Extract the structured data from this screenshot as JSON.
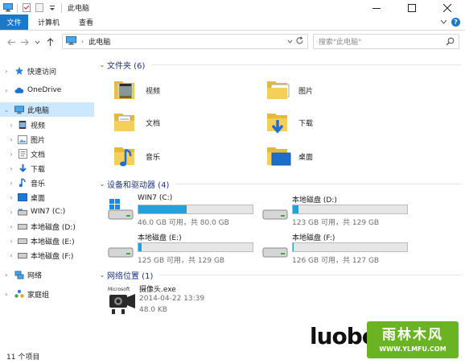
{
  "window": {
    "title": "此电脑",
    "controls": [
      "minimize-icon",
      "maximize-icon",
      "close-icon"
    ]
  },
  "ribbon": {
    "tabs": [
      {
        "label": "文件",
        "active": true
      },
      {
        "label": "计算机",
        "active": false
      },
      {
        "label": "查看",
        "active": false
      }
    ],
    "help_label": "?"
  },
  "address": {
    "path": "此电脑",
    "search_placeholder": "搜索\"此电脑\""
  },
  "nav": {
    "items": [
      {
        "label": "快速访问",
        "icon": "star-icon"
      },
      {
        "label": "OneDrive",
        "icon": "cloud-icon"
      },
      {
        "label": "此电脑",
        "icon": "computer-icon",
        "selected": true
      },
      {
        "label": "视频",
        "icon": "video-folder-icon"
      },
      {
        "label": "图片",
        "icon": "pictures-folder-icon"
      },
      {
        "label": "文档",
        "icon": "documents-folder-icon"
      },
      {
        "label": "下载",
        "icon": "download-arrow-icon"
      },
      {
        "label": "音乐",
        "icon": "music-note-icon"
      },
      {
        "label": "桌面",
        "icon": "desktop-folder-icon"
      },
      {
        "label": "WIN7 (C:)",
        "icon": "drive-icon"
      },
      {
        "label": "本地磁盘 (D:)",
        "icon": "drive-icon"
      },
      {
        "label": "本地磁盘 (E:)",
        "icon": "drive-icon"
      },
      {
        "label": "本地磁盘 (F:)",
        "icon": "drive-icon"
      },
      {
        "label": "网络",
        "icon": "network-icon"
      },
      {
        "label": "家庭组",
        "icon": "homegroup-icon"
      }
    ]
  },
  "groups": {
    "folders_title": "文件夹 (6)",
    "devices_title": "设备和驱动器 (4)",
    "network_title": "网络位置 (1)"
  },
  "folders": [
    {
      "label": "视频",
      "icon": "video-folder-icon"
    },
    {
      "label": "图片",
      "icon": "pictures-folder-icon"
    },
    {
      "label": "文档",
      "icon": "documents-folder-icon"
    },
    {
      "label": "下载",
      "icon": "download-folder-icon"
    },
    {
      "label": "音乐",
      "icon": "music-folder-icon"
    },
    {
      "label": "桌面",
      "icon": "desktop-folder-icon"
    }
  ],
  "drives": [
    {
      "name": "WIN7 (C:)",
      "free": "46.0 GB 可用，共 80.0 GB",
      "used_fraction": 0.425,
      "system": true
    },
    {
      "name": "本地磁盘 (D:)",
      "free": "123 GB 可用，共 129 GB",
      "used_fraction": 0.047,
      "system": false
    },
    {
      "name": "本地磁盘 (E:)",
      "free": "125 GB 可用，共 129 GB",
      "used_fraction": 0.031,
      "system": false
    },
    {
      "name": "本地磁盘 (F:)",
      "free": "126 GB 可用，共 127 GB",
      "used_fraction": 0.008,
      "system": false
    }
  ],
  "network_item": {
    "name": "摄像头.exe",
    "date": "2014-04-22 13:39",
    "size": "48.0 KB",
    "icon_text": "Microsoft"
  },
  "status": {
    "count": "11 个项目"
  },
  "watermark": {
    "left_text": "luobo",
    "title": "雨林木风",
    "url": "WWW.YLMFU.COM"
  }
}
